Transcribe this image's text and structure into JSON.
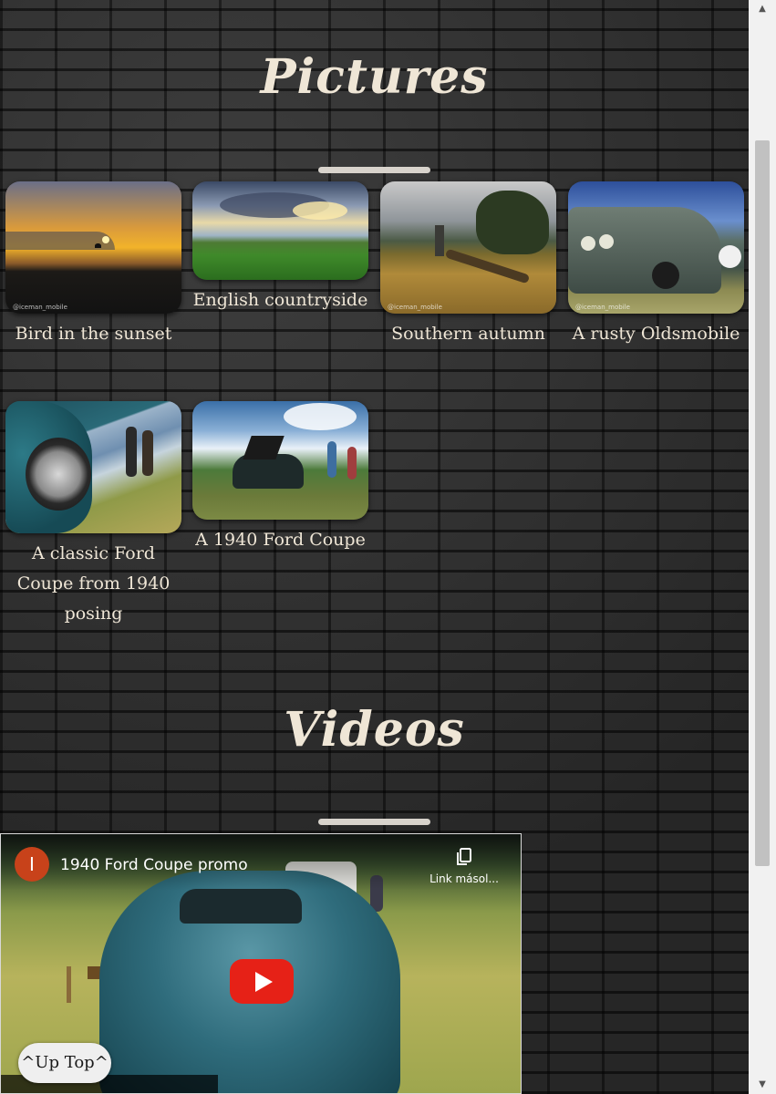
{
  "pictures": {
    "title": "Pictures",
    "items": [
      {
        "caption": "Bird in the sunset",
        "watermark": "@iceman_mobile"
      },
      {
        "caption": "English countryside",
        "watermark": ""
      },
      {
        "caption": "Southern autumn",
        "watermark": "@iceman_mobile"
      },
      {
        "caption": "A rusty Oldsmobile",
        "watermark": "@iceman_mobile"
      },
      {
        "caption": "A classic Ford Coupe from 1940 posing",
        "watermark": ""
      },
      {
        "caption": "A 1940 Ford Coupe",
        "watermark": ""
      }
    ]
  },
  "videos": {
    "title": "Videos",
    "player": {
      "channel_initial": "I",
      "title": "1940 Ford Coupe promo",
      "copy_link_label": "Link másol...",
      "play_icon": "play-icon",
      "copy_icon": "copy-icon"
    }
  },
  "up_top": {
    "label": "^Up Top^"
  },
  "scrollbar": {
    "up_arrow": "▲",
    "down_arrow": "▼"
  },
  "colors": {
    "heading": "#efe6d6",
    "divider": "#d8d3cc",
    "play_button": "#e62117",
    "avatar": "#c8421a"
  }
}
